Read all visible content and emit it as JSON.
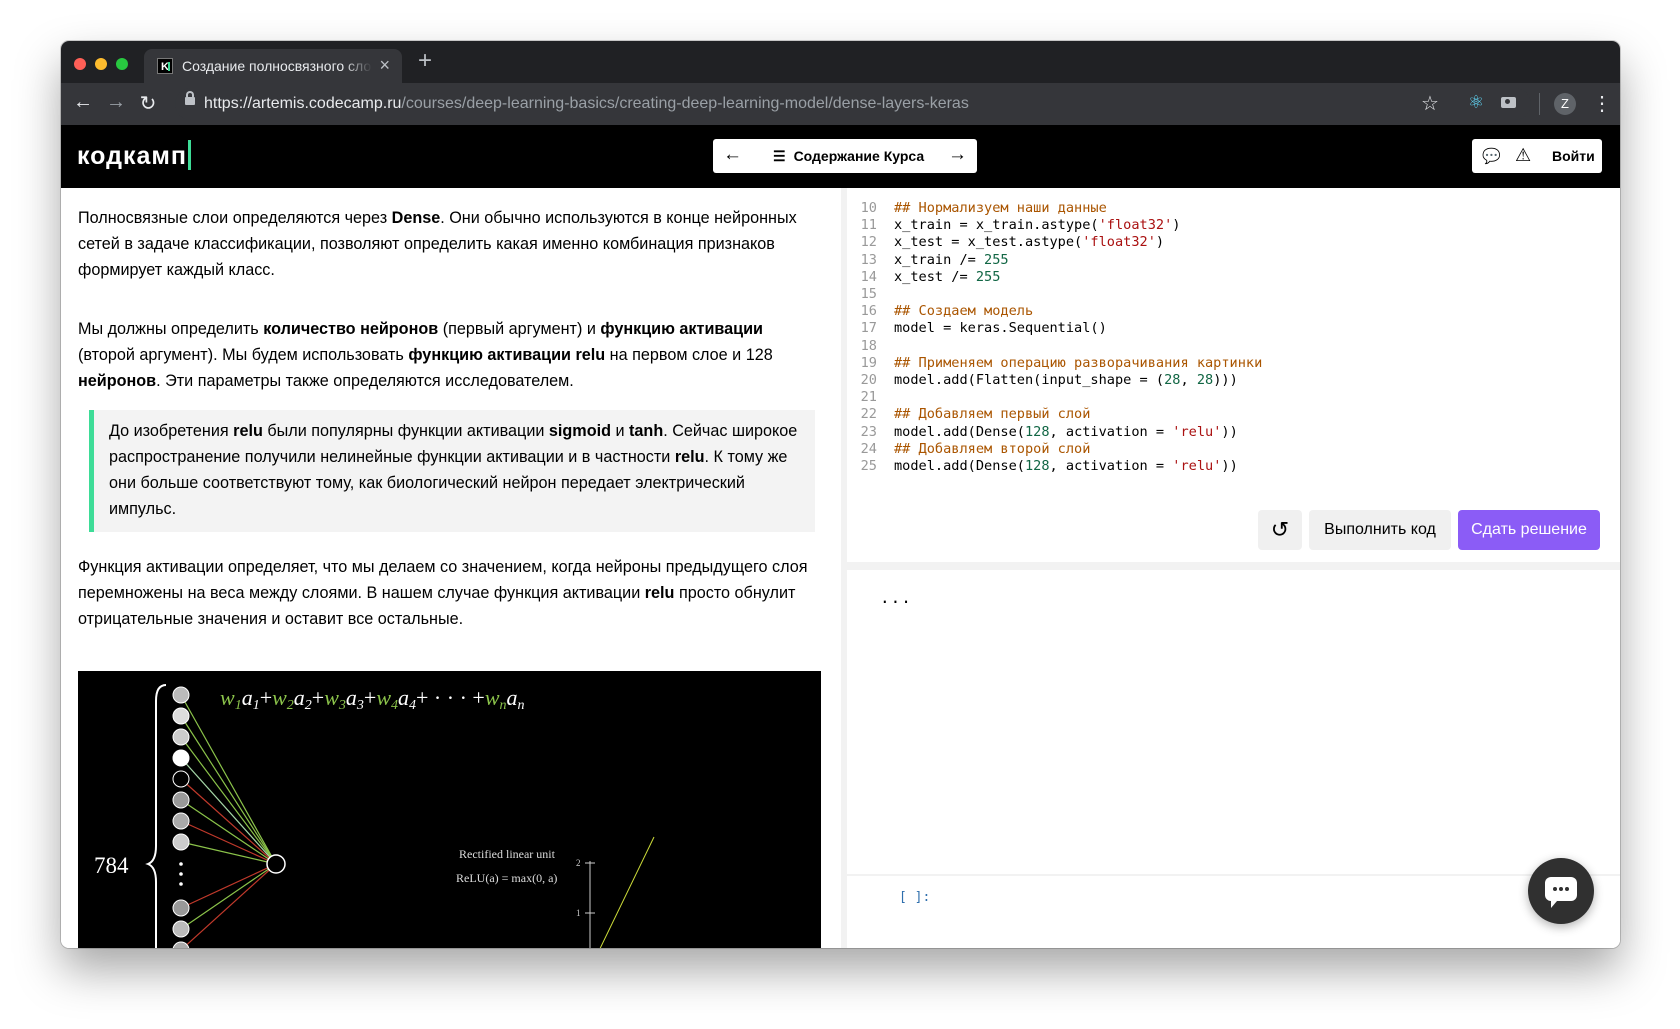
{
  "browser": {
    "tab_title": "Создание полносвязного слоя",
    "tab_favicon_letter": "K",
    "url_host": "https://artemis.codecamp.ru",
    "url_path": "/courses/deep-learning-basics/creating-deep-learning-model/dense-layers-keras",
    "profile_initial": "Z",
    "icons": {
      "back": "arrow-left-icon",
      "forward": "arrow-right-icon",
      "reload": "reload-icon",
      "lock": "lock-icon",
      "bookmark": "star-icon",
      "menu": "kebab-menu-icon"
    }
  },
  "site_header": {
    "logo": "кодкамп",
    "course_nav_label": "Содержание Курса",
    "login_label": "Войти",
    "accent_color": "#3ddc97"
  },
  "lesson": {
    "p1": [
      {
        "t": "Полносвязные слои определяются через "
      },
      {
        "t": "Dense",
        "b": true
      },
      {
        "t": ". Они обычно используются в конце нейронных сетей в задаче классификации, позволяют определить какая именно комбинация признаков формирует каждый класс."
      }
    ],
    "p2": [
      {
        "t": "Мы должны определить "
      },
      {
        "t": "количество нейронов",
        "b": true
      },
      {
        "t": " (первый аргумент) и "
      },
      {
        "t": "функцию активации",
        "b": true
      },
      {
        "t": " (второй аргумент). Мы будем использовать "
      },
      {
        "t": "функцию активации relu",
        "b": true
      },
      {
        "t": " на первом слое и 128 "
      },
      {
        "t": "нейронов",
        "b": true
      },
      {
        "t": ". Эти параметры также определяются исследователем."
      }
    ],
    "quote": [
      {
        "t": "До изобретения "
      },
      {
        "t": "relu",
        "b": true
      },
      {
        "t": " были популярны функции активации "
      },
      {
        "t": "sigmoid",
        "b": true
      },
      {
        "t": " и "
      },
      {
        "t": "tanh",
        "b": true
      },
      {
        "t": ". Сейчас широкое распространение получили нелинейные функции активации и в частности "
      },
      {
        "t": "relu",
        "b": true
      },
      {
        "t": ". К тому же они больше соответствуют тому, как биологический нейрон передает электрический импульс."
      }
    ],
    "p3": [
      {
        "t": "Функция активации определяет, что мы делаем со значением, когда нейроны предыдущего слоя перемножены на веса между слоями. В нашем случае функция активации "
      },
      {
        "t": "relu",
        "b": true
      },
      {
        "t": " просто обнулит отрицательные значения и оставит все остальные."
      }
    ],
    "figure": {
      "input_count": "784",
      "graph_title": "Rectified linear unit",
      "graph_formula": "ReLU(a) = max(0, a)",
      "tick_2": "2",
      "tick_1": "1"
    }
  },
  "editor": {
    "lines": [
      {
        "n": "10",
        "tokens": [
          {
            "t": "## Нормализуем наши данные",
            "c": "comment"
          }
        ]
      },
      {
        "n": "11",
        "tokens": [
          {
            "t": "x_train = x_train.astype("
          },
          {
            "t": "'float32'",
            "c": "str"
          },
          {
            "t": ")"
          }
        ]
      },
      {
        "n": "12",
        "tokens": [
          {
            "t": "x_test = x_test.astype("
          },
          {
            "t": "'float32'",
            "c": "str"
          },
          {
            "t": ")"
          }
        ]
      },
      {
        "n": "13",
        "tokens": [
          {
            "t": "x_train /= "
          },
          {
            "t": "255",
            "c": "num"
          }
        ]
      },
      {
        "n": "14",
        "tokens": [
          {
            "t": "x_test /= "
          },
          {
            "t": "255",
            "c": "num"
          }
        ]
      },
      {
        "n": "15",
        "tokens": []
      },
      {
        "n": "16",
        "tokens": [
          {
            "t": "## Создаем модель",
            "c": "comment"
          }
        ]
      },
      {
        "n": "17",
        "tokens": [
          {
            "t": "model = keras.Sequential()"
          }
        ]
      },
      {
        "n": "18",
        "tokens": []
      },
      {
        "n": "19",
        "tokens": [
          {
            "t": "## Применяем операцию разворачивания картинки",
            "c": "comment"
          }
        ]
      },
      {
        "n": "20",
        "tokens": [
          {
            "t": "model.add(Flatten(input_shape = ("
          },
          {
            "t": "28",
            "c": "num"
          },
          {
            "t": ", "
          },
          {
            "t": "28",
            "c": "num"
          },
          {
            "t": ")))"
          }
        ]
      },
      {
        "n": "21",
        "tokens": []
      },
      {
        "n": "22",
        "tokens": [
          {
            "t": "## Добавляем первый слой",
            "c": "comment"
          }
        ]
      },
      {
        "n": "23",
        "tokens": [
          {
            "t": "model.add(Dense("
          },
          {
            "t": "128",
            "c": "num"
          },
          {
            "t": ", activation = "
          },
          {
            "t": "'relu'",
            "c": "str"
          },
          {
            "t": "))"
          }
        ]
      },
      {
        "n": "24",
        "tokens": [
          {
            "t": "## Добавляем второй слой",
            "c": "comment"
          }
        ]
      },
      {
        "n": "25",
        "tokens": [
          {
            "t": "model.add(Dense("
          },
          {
            "t": "128",
            "c": "num"
          },
          {
            "t": ", activation = "
          },
          {
            "t": "'relu'",
            "c": "str"
          },
          {
            "t": "))"
          }
        ]
      }
    ],
    "run_label": "Выполнить код",
    "submit_label": "Сдать решение",
    "submit_color": "#8b5cf6"
  },
  "output": {
    "text": "...",
    "cell_prompt": "[ ]:"
  }
}
